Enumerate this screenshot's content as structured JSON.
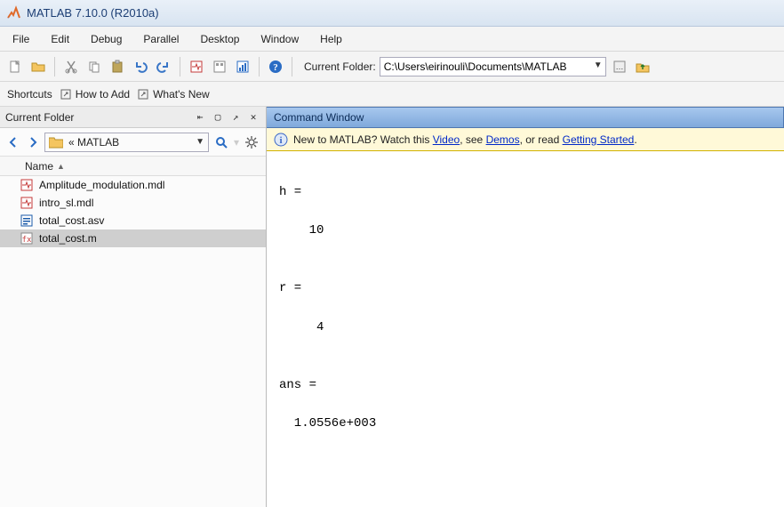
{
  "title": "MATLAB  7.10.0 (R2010a)",
  "menu": [
    "File",
    "Edit",
    "Debug",
    "Parallel",
    "Desktop",
    "Window",
    "Help"
  ],
  "toolbar": {
    "current_folder_label": "Current Folder:",
    "current_folder_path": "C:\\Users\\eirinouli\\Documents\\MATLAB"
  },
  "shortcuts": {
    "label": "Shortcuts",
    "how_to_add": "How to Add",
    "whats_new": "What's New"
  },
  "left": {
    "panel_title": "Current Folder",
    "path_crumb": "« MATLAB",
    "col_header": "Name",
    "files": [
      {
        "name": "Amplitude_modulation.mdl",
        "icon": "mdl"
      },
      {
        "name": "intro_sl.mdl",
        "icon": "mdl"
      },
      {
        "name": "total_cost.asv",
        "icon": "asv"
      },
      {
        "name": "total_cost.m",
        "icon": "m",
        "selected": true
      }
    ]
  },
  "cmd": {
    "header": "Command Window",
    "info_prefix": "New to MATLAB? Watch this ",
    "info_video": "Video",
    "info_mid1": ", see ",
    "info_demos": "Demos",
    "info_mid2": ", or read ",
    "info_gs": "Getting Started",
    "info_suffix": ".",
    "output": "\nh =\n\n    10\n\n\nr =\n\n     4\n\n\nans =\n\n  1.0556e+003"
  }
}
